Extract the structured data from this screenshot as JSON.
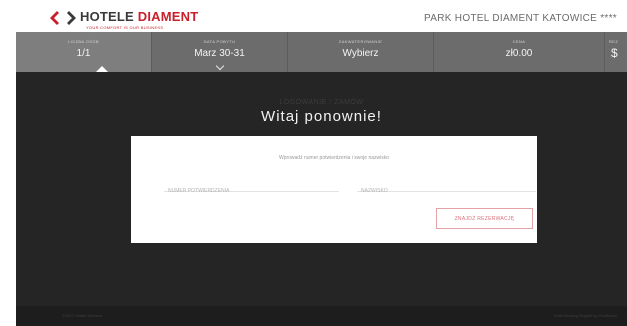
{
  "header": {
    "logo_text_a": "HOTELE ",
    "logo_text_b": "DIAMENT",
    "logo_tagline": "YOUR COMFORT IS OUR BUSINESS",
    "hotel_name": "PARK HOTEL DIAMENT KATOWICE ****"
  },
  "booking_bar": {
    "items": [
      {
        "label": "LICZBA OSÓB",
        "value": "1/1"
      },
      {
        "label": "DATA POBYTU",
        "value": "Marz 30-31"
      },
      {
        "label": "ZAKWATEROWANIE",
        "value": "Wybierz"
      },
      {
        "label": "CENA",
        "value": "zł0.00"
      },
      {
        "label": "REZ",
        "value": "$"
      }
    ]
  },
  "overlay": {
    "title_ghost": "LOGOWANIE / ZAMÓW",
    "title": "Witaj ponownie!"
  },
  "modal": {
    "instruction": "Wprowadź numer potwierdzenia i swoje nazwisko",
    "confirmation_placeholder": "NUMER POTWIERDZENIA",
    "surname_placeholder": "NAZWISKO",
    "submit_label": "ZNAJDŹ REZERWACJĘ"
  },
  "footer": {
    "left": "©2017 Hotele Diament",
    "right": "Hotel Booking Engine by Profitroom"
  },
  "colors": {
    "brand_red": "#c8202b",
    "bar_grey": "#6c6c6c",
    "overlay": "#252525"
  }
}
